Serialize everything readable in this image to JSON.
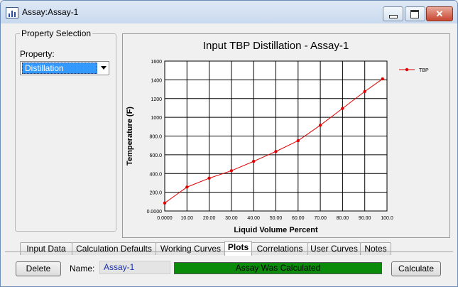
{
  "window": {
    "title": "Assay:Assay-1",
    "close_glyph": "✕"
  },
  "property_selection": {
    "group_title": "Property Selection",
    "property_label": "Property:",
    "selected_value": "Distillation"
  },
  "chart_data": {
    "type": "line",
    "title": "Input TBP Distillation - Assay-1",
    "xlabel": "Liquid Volume Percent",
    "ylabel": "Temperature (F)",
    "xlim": [
      0,
      100
    ],
    "ylim": [
      0,
      1600
    ],
    "x_ticks": [
      "0.0000",
      "10.00",
      "20.00",
      "30.00",
      "40.00",
      "50.00",
      "60.00",
      "70.00",
      "80.00",
      "90.00",
      "100.0"
    ],
    "y_ticks": [
      "0.0000",
      "200.0",
      "400.0",
      "600.0",
      "800.0",
      "1000",
      "1200",
      "1400",
      "1600"
    ],
    "grid": true,
    "legend_position": "top-right",
    "series": [
      {
        "name": "TBP",
        "color": "#e00000",
        "x": [
          0,
          10,
          20,
          30,
          40,
          50,
          60,
          70,
          80,
          90,
          98
        ],
        "y": [
          85,
          255,
          350,
          430,
          530,
          635,
          750,
          915,
          1095,
          1275,
          1410
        ]
      }
    ]
  },
  "tabs": [
    {
      "label": "Input Data",
      "active": false
    },
    {
      "label": "Calculation Defaults",
      "active": false
    },
    {
      "label": "Working Curves",
      "active": false
    },
    {
      "label": "Plots",
      "active": true
    },
    {
      "label": "Correlations",
      "active": false
    },
    {
      "label": "User Curves",
      "active": false
    },
    {
      "label": "Notes",
      "active": false
    }
  ],
  "bottom": {
    "delete_label": "Delete",
    "name_label": "Name:",
    "name_value": "Assay-1",
    "status_text": "Assay Was Calculated",
    "calculate_label": "Calculate"
  },
  "colors": {
    "status_green": "#0a8c0a",
    "selection_blue": "#3399ff",
    "series_red": "#e00000"
  }
}
